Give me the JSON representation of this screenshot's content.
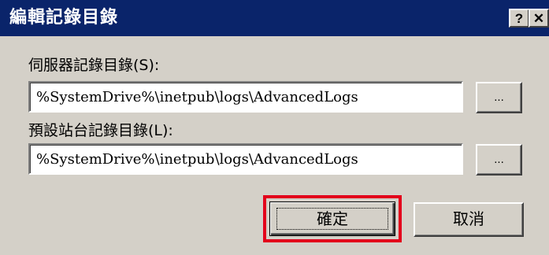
{
  "window": {
    "title": "編輯記錄目錄",
    "help_label": "?",
    "close_label": "✕",
    "titlebar_color": "#0a246a",
    "background_color": "#d4d0c8"
  },
  "server_log_dir": {
    "label": "伺服器記錄目錄(S):",
    "value": "%SystemDrive%\\inetpub\\logs\\AdvancedLogs",
    "browse_label": "..."
  },
  "default_site_log_dir": {
    "label": "預設站台記錄目錄(L):",
    "value": "%SystemDrive%\\inetpub\\logs\\AdvancedLogs",
    "browse_label": "..."
  },
  "buttons": {
    "ok_label": "確定",
    "cancel_label": "取消"
  },
  "highlight": {
    "target": "ok-button",
    "color": "#e3001b"
  }
}
